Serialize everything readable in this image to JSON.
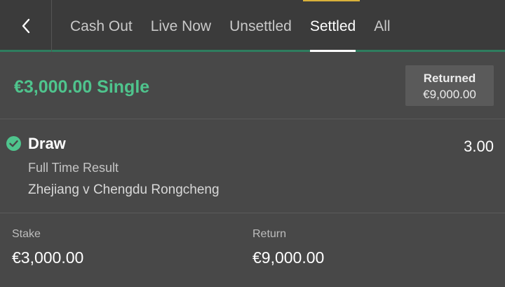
{
  "nav": {
    "back_icon": "chevron-left-icon",
    "tabs": [
      {
        "label": "Cash Out"
      },
      {
        "label": "Live Now"
      },
      {
        "label": "Unsettled"
      },
      {
        "label": "Settled"
      },
      {
        "label": "All"
      }
    ],
    "active_tab": "Settled"
  },
  "bet": {
    "title": "€3,000.00 Single",
    "status_label": "Returned",
    "status_amount": "€9,000.00"
  },
  "selection": {
    "status_icon": "check-circle-icon",
    "name": "Draw",
    "odds": "3.00",
    "market": "Full Time Result",
    "event": "Zhejiang v Chengdu Rongcheng"
  },
  "summary": {
    "stake_label": "Stake",
    "stake_value": "€3,000.00",
    "return_label": "Return",
    "return_value": "€9,000.00"
  },
  "colors": {
    "accent_green": "#4fc48d",
    "background": "#484848",
    "topbar": "#3b3b3b"
  }
}
